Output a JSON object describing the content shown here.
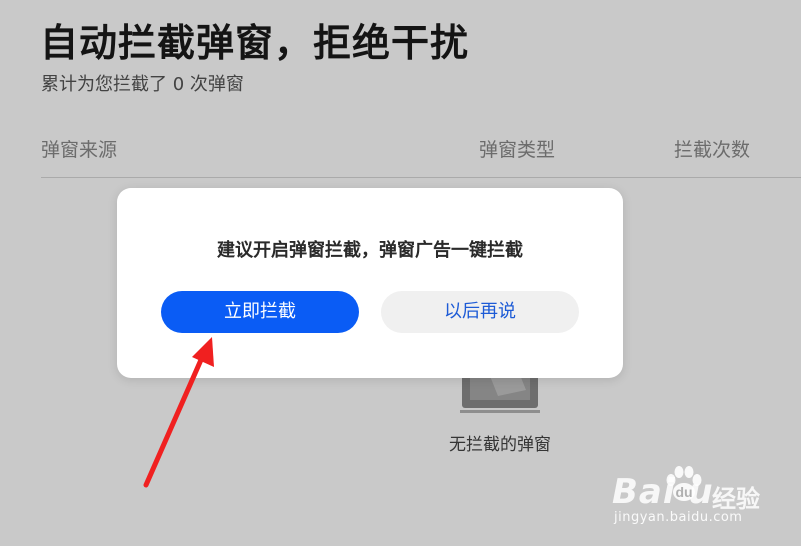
{
  "header": {
    "title": "自动拦截弹窗，拒绝干扰",
    "subtitle": "累计为您拦截了 0 次弹窗"
  },
  "table": {
    "columns": [
      "弹窗来源",
      "弹窗类型",
      "拦截次数"
    ]
  },
  "empty_state": {
    "icon": "empty-box-icon",
    "text": "无拦截的弹窗"
  },
  "dialog": {
    "message": "建议开启弹窗拦截，弹窗广告一键拦截",
    "primary_label": "立即拦截",
    "secondary_label": "以后再说"
  },
  "watermark": {
    "brand": "Bai  u",
    "cn": "经验",
    "url": "jingyan.baidu.com"
  },
  "colors": {
    "primary_button": "#0a5cf5",
    "secondary_text": "#1d5bd6",
    "arrow": "#f02020"
  }
}
